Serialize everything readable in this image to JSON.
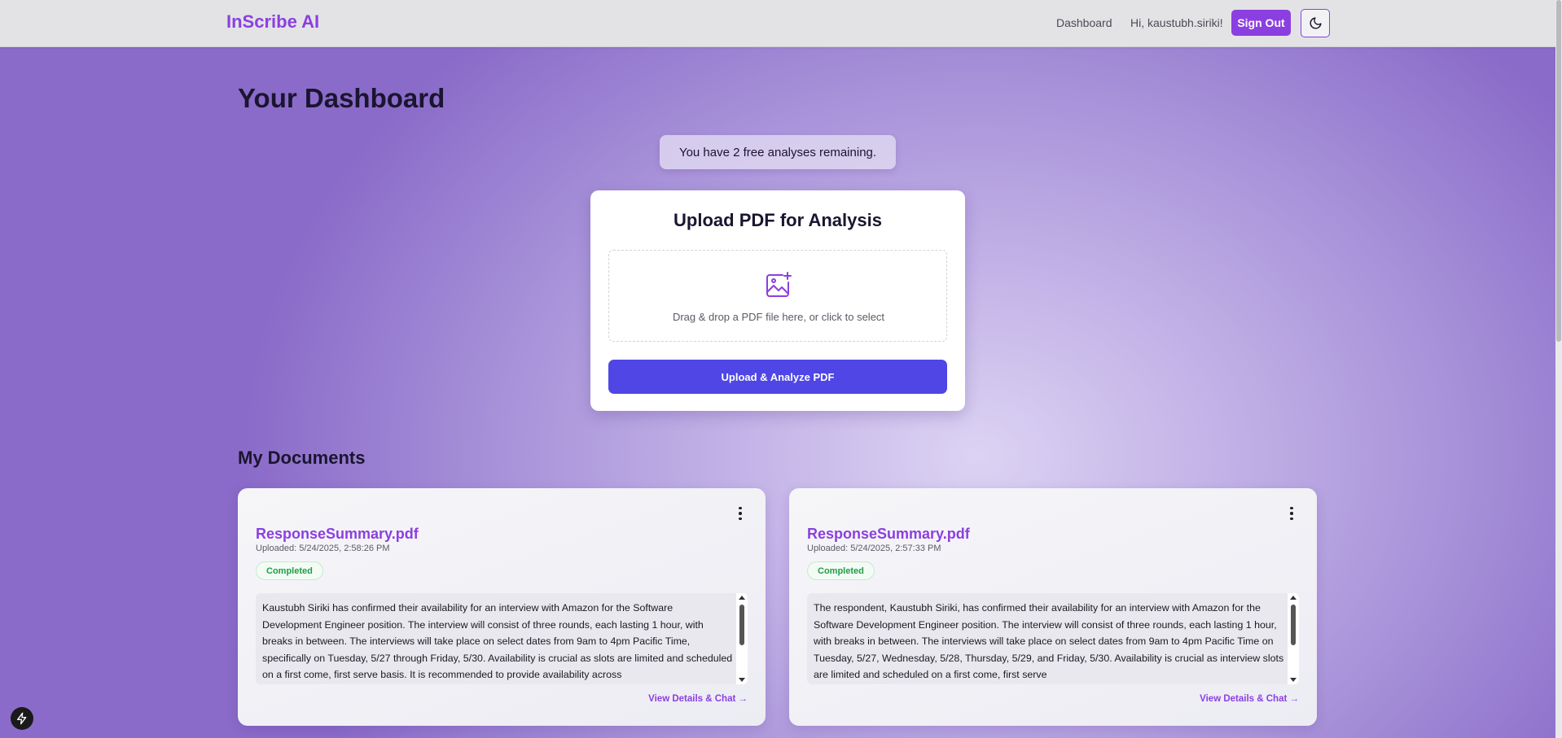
{
  "header": {
    "brand": "InScribe AI",
    "nav_dashboard": "Dashboard",
    "greeting": "Hi, kaustubh.siriki!",
    "sign_out": "Sign Out",
    "theme_icon": "moon-icon"
  },
  "page": {
    "title": "Your Dashboard",
    "notice": "You have 2 free analyses remaining."
  },
  "upload": {
    "title": "Upload PDF for Analysis",
    "icon": "image-plus-icon",
    "dropzone_text": "Drag & drop a PDF file here, or click to select",
    "button": "Upload & Analyze PDF"
  },
  "documents": {
    "section_title": "My Documents",
    "items": [
      {
        "name": "ResponseSummary.pdf",
        "uploaded": "Uploaded: 5/24/2025, 2:58:26 PM",
        "status": "Completed",
        "summary": "Kaustubh Siriki has confirmed their availability for an interview with Amazon for the Software Development Engineer position. The interview will consist of three rounds, each lasting 1 hour, with breaks in between. The interviews will take place on select dates from 9am to 4pm Pacific Time, specifically on Tuesday, 5/27 through Friday, 5/30. Availability is crucial as slots are limited and scheduled on a first come, first serve basis. It is recommended to provide availability across",
        "link": "View Details & Chat →"
      },
      {
        "name": "ResponseSummary.pdf",
        "uploaded": "Uploaded: 5/24/2025, 2:57:33 PM",
        "status": "Completed",
        "summary": "The respondent, Kaustubh Siriki, has confirmed their availability for an interview with Amazon for the Software Development Engineer position. The interview will consist of three rounds, each lasting 1 hour, with breaks in between. The interviews will take place on select dates from 9am to 4pm Pacific Time on Tuesday, 5/27, Wednesday, 5/28, Thursday, 5/29, and Friday, 5/30. Availability is crucial as interview slots are limited and scheduled on a first come, first serve",
        "link": "View Details & Chat →"
      }
    ]
  },
  "colors": {
    "brand": "#8b3fe0",
    "primary_button": "#4f46e5",
    "status_completed": "#1f9d47"
  }
}
